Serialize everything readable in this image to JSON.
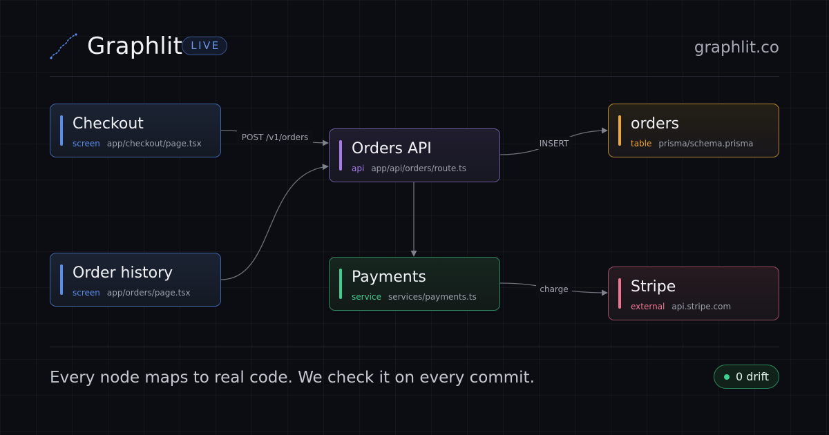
{
  "header": {
    "brand": "Graphlit",
    "badge": "LIVE",
    "site": "graphlit.co",
    "logo_icon": "graph-squiggle-icon"
  },
  "nodes": {
    "checkout": {
      "title": "Checkout",
      "kind": "screen",
      "path": "app/checkout/page.tsx",
      "color": "#5b8def"
    },
    "order_history": {
      "title": "Order history",
      "kind": "screen",
      "path": "app/orders/page.tsx",
      "color": "#5b8def"
    },
    "orders_api": {
      "title": "Orders API",
      "kind": "api",
      "path": "app/api/orders/route.ts",
      "color": "#a77ce8"
    },
    "payments": {
      "title": "Payments",
      "kind": "service",
      "path": "services/payments.ts",
      "color": "#3fcf8e"
    },
    "orders": {
      "title": "orders",
      "kind": "table",
      "path": "prisma/schema.prisma",
      "color": "#f0a73a"
    },
    "stripe": {
      "title": "Stripe",
      "kind": "external",
      "path": "api.stripe.com",
      "color": "#ee7592"
    }
  },
  "edges": [
    {
      "from": "Checkout",
      "to": "Orders API",
      "label": "POST /v1/orders"
    },
    {
      "from": "Order history",
      "to": "Orders API",
      "label": ""
    },
    {
      "from": "Orders API",
      "to": "orders",
      "label": "INSERT"
    },
    {
      "from": "Orders API",
      "to": "Payments",
      "label": ""
    },
    {
      "from": "Payments",
      "to": "Stripe",
      "label": "charge"
    }
  ],
  "footer": {
    "tagline": "Every node maps to real code. We check it on every commit.",
    "drift": "0 drift",
    "drift_color": "#3fcf8e"
  }
}
